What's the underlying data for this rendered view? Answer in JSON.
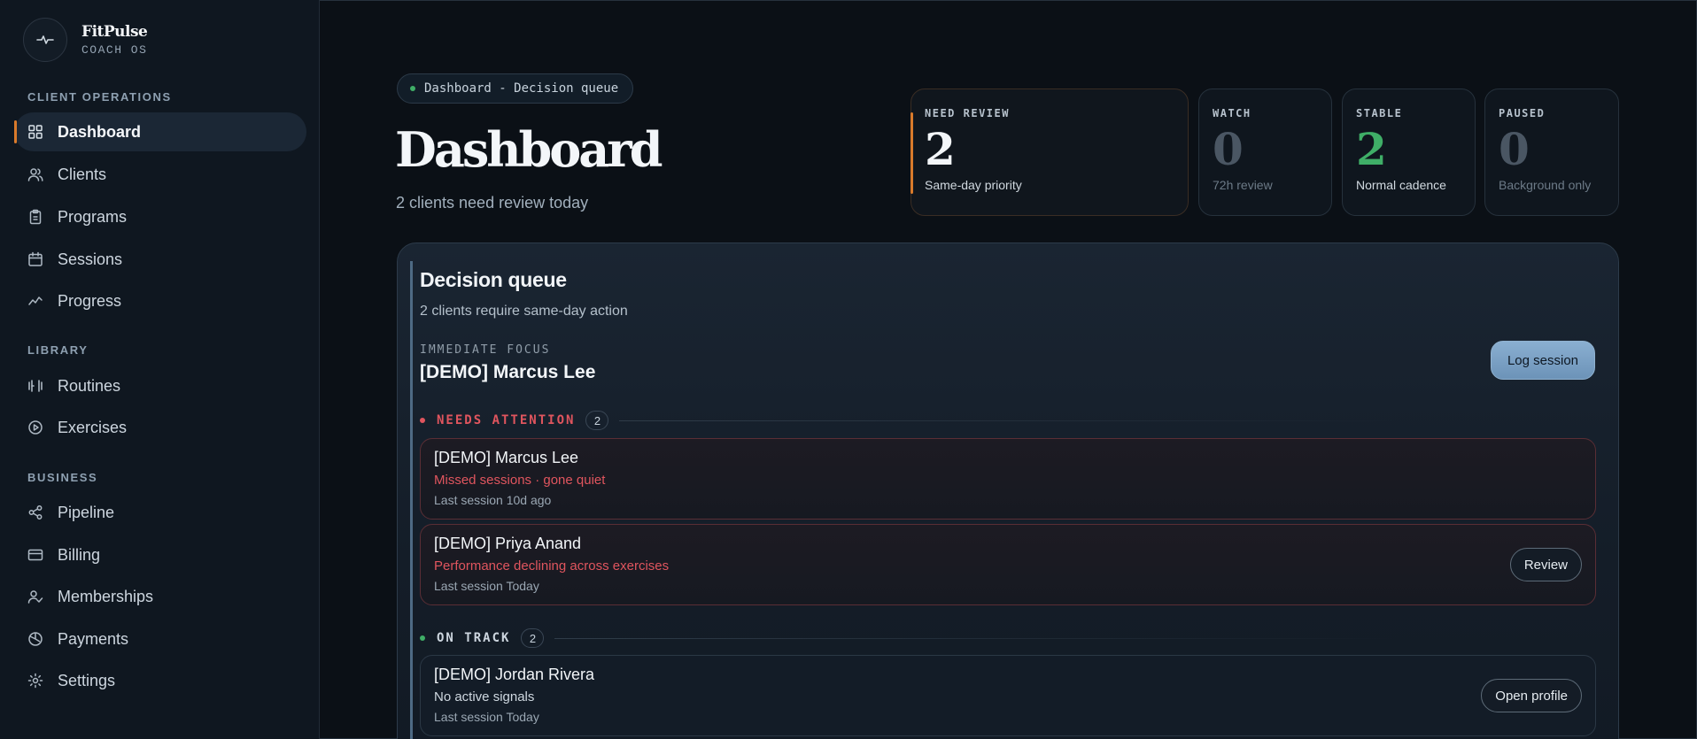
{
  "brand": {
    "name": "FitPulse",
    "subtitle": "COACH OS"
  },
  "sidebar": {
    "sections": [
      {
        "heading": "CLIENT OPERATIONS"
      },
      {
        "heading": "LIBRARY"
      },
      {
        "heading": "BUSINESS"
      }
    ],
    "items": [
      {
        "label": "Dashboard",
        "icon": "grid-icon",
        "active": true
      },
      {
        "label": "Clients",
        "icon": "users-icon"
      },
      {
        "label": "Programs",
        "icon": "clipboard-icon"
      },
      {
        "label": "Sessions",
        "icon": "calendar-icon"
      },
      {
        "label": "Progress",
        "icon": "trend-icon"
      },
      {
        "label": "Routines",
        "icon": "dumbbell-icon"
      },
      {
        "label": "Exercises",
        "icon": "play-circle-icon"
      },
      {
        "label": "Pipeline",
        "icon": "share-nodes-icon"
      },
      {
        "label": "Billing",
        "icon": "credit-card-icon"
      },
      {
        "label": "Memberships",
        "icon": "user-check-icon"
      },
      {
        "label": "Payments",
        "icon": "coins-icon"
      },
      {
        "label": "Settings",
        "icon": "gear-icon"
      }
    ]
  },
  "header": {
    "chip": "Dashboard - Decision queue",
    "title": "Dashboard",
    "subtitle": "2 clients need review today"
  },
  "stats": [
    {
      "label": "NEED REVIEW",
      "value": "2",
      "note": "Same-day priority"
    },
    {
      "label": "WATCH",
      "value": "0",
      "note": "72h review"
    },
    {
      "label": "STABLE",
      "value": "2",
      "note": "Normal cadence"
    },
    {
      "label": "PAUSED",
      "value": "0",
      "note": "Background only"
    }
  ],
  "colors": {
    "accent": "#d97a2b",
    "alert": "#e0555e",
    "success": "#3fae67",
    "primary_button": "#7ea3c6"
  },
  "queue": {
    "title": "Decision queue",
    "subtitle": "2 clients require same-day action",
    "focus_label": "IMMEDIATE FOCUS",
    "focus_name": "[DEMO] Marcus Lee",
    "log_button": "Log session",
    "groups": [
      {
        "label": "NEEDS ATTENTION",
        "count": "2",
        "rows": [
          {
            "name": "[DEMO] Marcus Lee",
            "signal": "Missed sessions · gone quiet",
            "meta": "Last session 10d ago",
            "action": ""
          },
          {
            "name": "[DEMO] Priya Anand",
            "signal": "Performance declining across exercises",
            "meta": "Last session Today",
            "action": "Review"
          }
        ]
      },
      {
        "label": "ON TRACK",
        "count": "2",
        "rows": [
          {
            "name": "[DEMO] Jordan Rivera",
            "signal": "No active signals",
            "meta": "Last session Today",
            "action": "Open profile"
          }
        ]
      }
    ]
  }
}
